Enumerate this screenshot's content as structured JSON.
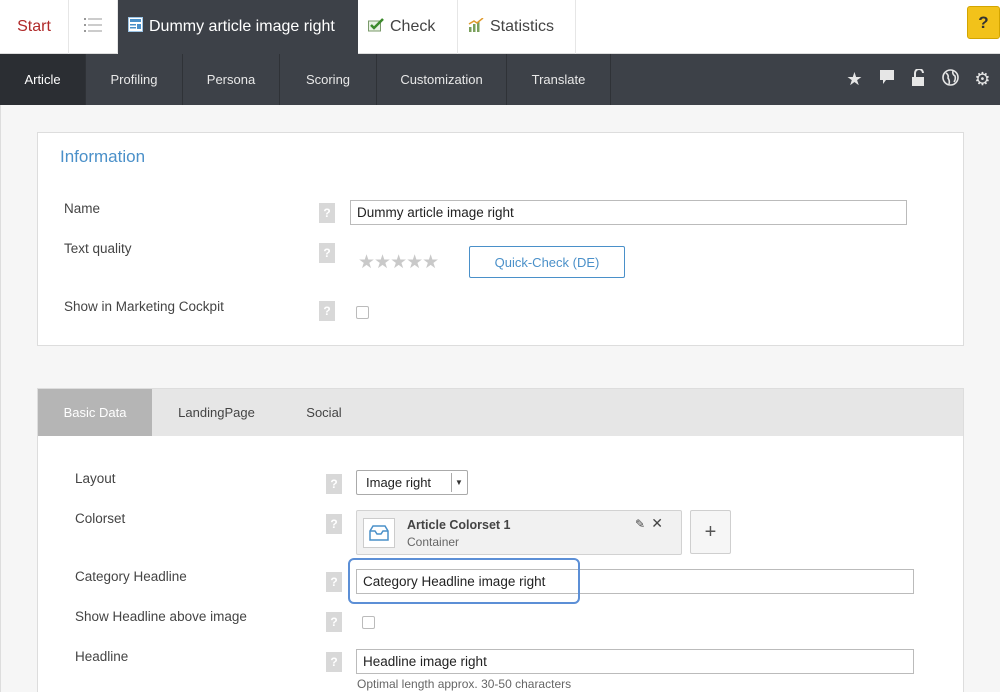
{
  "top_tabs": {
    "start": "Start",
    "document": "Dummy article image right",
    "check": "Check",
    "statistics": "Statistics",
    "help": "?"
  },
  "sub_nav": [
    "Article",
    "Profiling",
    "Persona",
    "Scoring",
    "Customization",
    "Translate"
  ],
  "nav_icons": [
    "star-icon",
    "comment-icon",
    "unlock-icon",
    "globe-icon",
    "gear-icon"
  ],
  "information": {
    "title": "Information",
    "name_label": "Name",
    "name_value": "Dummy article image right",
    "quality_label": "Text quality",
    "quality_rating": 0,
    "quickcheck_label": "Quick-Check (DE)",
    "cockpit_label": "Show in Marketing Cockpit"
  },
  "basic_tabs": [
    "Basic Data",
    "LandingPage",
    "Social"
  ],
  "basic": {
    "layout_label": "Layout",
    "layout_value": "Image right",
    "colorset_label": "Colorset",
    "colorset_name": "Article Colorset 1",
    "colorset_type": "Container",
    "category_label": "Category Headline",
    "category_value": "Category Headline image right",
    "show_headline_label": "Show Headline above image",
    "headline_label": "Headline",
    "headline_value": "Headline image right",
    "headline_hint": "Optimal length approx. 30-50 characters"
  },
  "colors": {
    "accent": "#4a90c9",
    "dark_nav": "#3d4148",
    "help_yellow": "#f2c21a",
    "start_red": "#b02a2a"
  }
}
